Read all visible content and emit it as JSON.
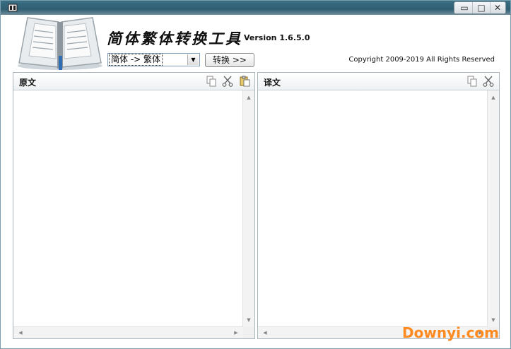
{
  "window": {
    "minimize_glyph": "▭",
    "maximize_glyph": "□",
    "close_glyph": "✕"
  },
  "header": {
    "title": "简体繁体转换工具",
    "version": "Version 1.6.5.0",
    "copyright": "Copyright 2009-2019 All Rights Reserved"
  },
  "controls": {
    "direction_selected": "简体 -> 繁体",
    "convert_button": "转换 >>"
  },
  "left_pane": {
    "title": "原文",
    "tools": [
      "copy-icon",
      "cut-icon",
      "paste-icon"
    ]
  },
  "right_pane": {
    "title": "译文",
    "tools": [
      "copy-icon",
      "cut-icon"
    ]
  },
  "watermark": {
    "text": "Downyi.com"
  },
  "colors": {
    "titlebar": "#2f5e72",
    "watermark": "#ff8a1f"
  }
}
